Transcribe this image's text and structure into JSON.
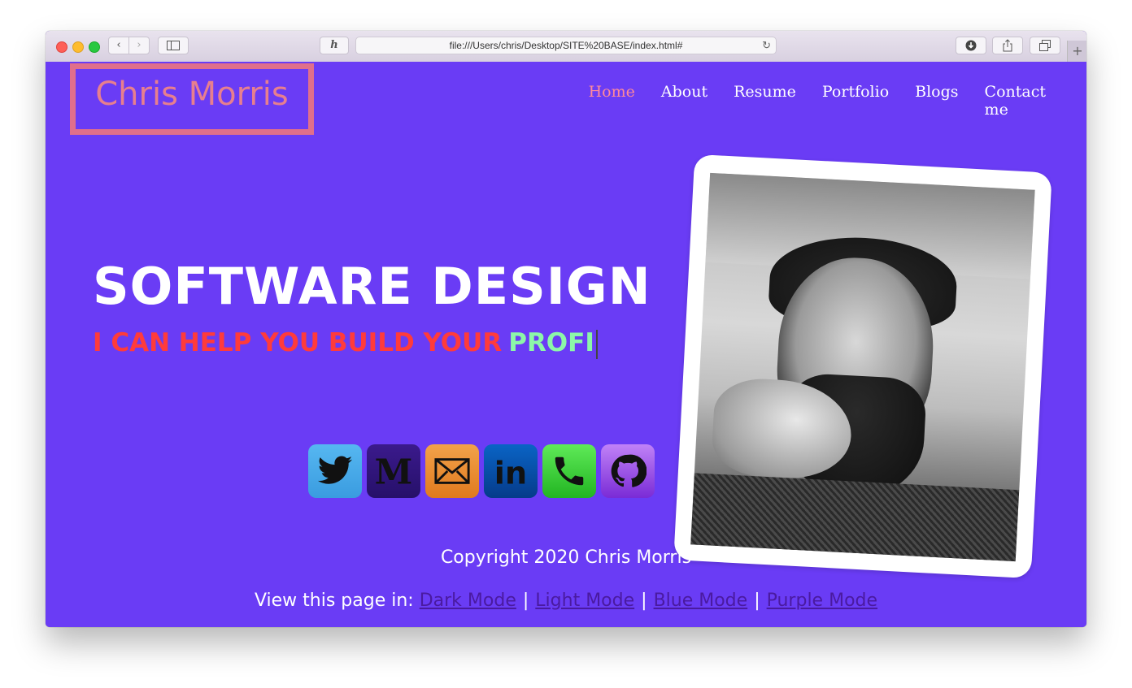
{
  "browser": {
    "url": "file:///Users/chris/Desktop/SITE%20BASE/index.html#",
    "reader_label": "h"
  },
  "header": {
    "logo": "Chris Morris",
    "nav": [
      {
        "label": "Home",
        "active": true
      },
      {
        "label": "About",
        "active": false
      },
      {
        "label": "Resume",
        "active": false
      },
      {
        "label": "Portfolio",
        "active": false
      },
      {
        "label": "Blogs",
        "active": false
      },
      {
        "label": "Contact me",
        "active": false
      }
    ]
  },
  "hero": {
    "title": "SOFTWARE DESIGN",
    "subtitle_static": "I CAN HELP YOU BUILD YOUR",
    "subtitle_typed": "PROFI"
  },
  "socials": [
    {
      "name": "twitter-icon",
      "color": "#3a9ce0"
    },
    {
      "name": "medium-icon",
      "color": "#26106a",
      "glyph": "M"
    },
    {
      "name": "mail-icon",
      "color": "#e07a1e"
    },
    {
      "name": "linkedin-icon",
      "color": "#053b8a",
      "glyph": "in"
    },
    {
      "name": "phone-icon",
      "color": "#22b522"
    },
    {
      "name": "github-icon",
      "color": "#7a2bd6"
    }
  ],
  "footer": {
    "copyright": "Copyright 2020 Chris Morris",
    "modes_prefix": "View this page in:",
    "modes": [
      "Dark Mode",
      "Light Mode",
      "Blue Mode",
      "Purple Mode"
    ],
    "separator": "|"
  },
  "colors": {
    "background": "#6a3cf5",
    "logo": "#e77f8e",
    "nav_active": "#ff8a9a",
    "subtitle_red": "#ff3b3b",
    "subtitle_green": "#8cf7a8",
    "mode_link": "#4a1aa0"
  }
}
